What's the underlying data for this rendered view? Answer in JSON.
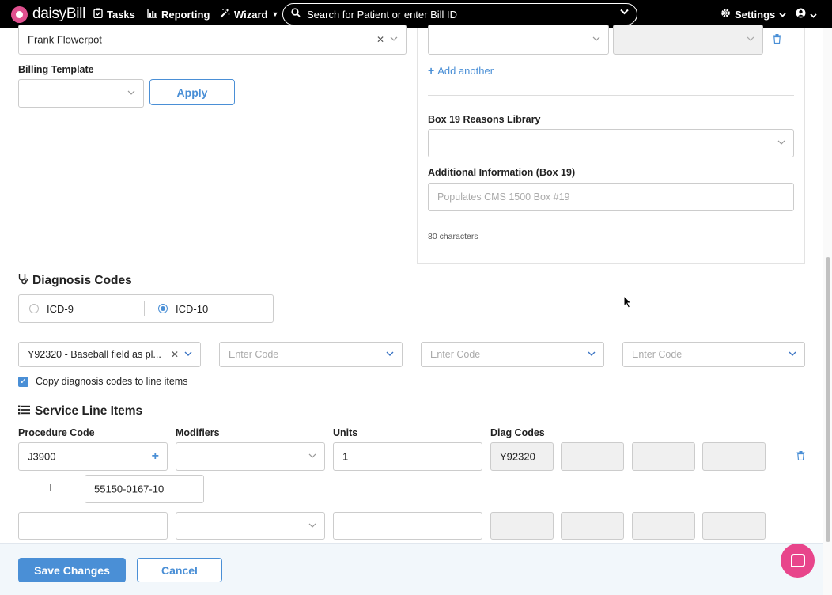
{
  "nav": {
    "logo": "daisyBill",
    "tasks": "Tasks",
    "reporting": "Reporting",
    "wizard": "Wizard",
    "search_placeholder": "Search for Patient or enter Bill ID",
    "settings": "Settings"
  },
  "form": {
    "provider_value": "Frank Flowerpot",
    "billing_template_label": "Billing Template",
    "apply_label": "Apply",
    "add_another_label": "Add another",
    "box19_library_label": "Box 19 Reasons Library",
    "additional_info_label": "Additional Information (Box 19)",
    "additional_info_placeholder": "Populates CMS 1500 Box #19",
    "char_count": "80 characters"
  },
  "diagnosis": {
    "title": "Diagnosis Codes",
    "icd9_label": "ICD-9",
    "icd10_label": "ICD-10",
    "selected_standard": "ICD-10",
    "code1_value": "Y92320 - Baseball field as pl...",
    "code_placeholder": "Enter Code",
    "copy_label": "Copy diagnosis codes to line items",
    "copy_checked": true
  },
  "service_lines": {
    "title": "Service Line Items",
    "headers": {
      "procedure": "Procedure Code",
      "modifiers": "Modifiers",
      "units": "Units",
      "diag": "Diag Codes"
    },
    "row1": {
      "procedure": "J3900",
      "units": "1",
      "diag1": "Y92320",
      "ndc": "55150-0167-10"
    }
  },
  "footer": {
    "save_label": "Save Changes",
    "cancel_label": "Cancel"
  },
  "colors": {
    "accent": "#4a8fd6",
    "brand": "#e0508f",
    "nav_bg": "#000000"
  }
}
